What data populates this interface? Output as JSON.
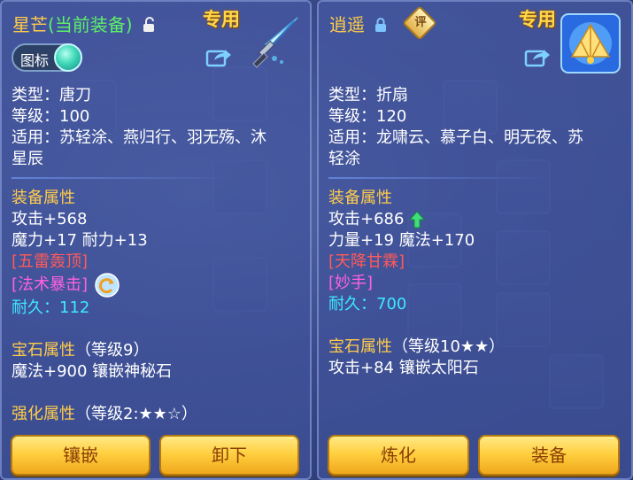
{
  "left": {
    "title_name": "星芒",
    "title_status": "(当前装备)",
    "exclusive_label": "专用",
    "toggle_label": "图标",
    "type_line": "类型：唐刀",
    "level_line": "等级：100",
    "usable_line1": "适用：苏轻涂、燕归行、羽无殇、沐",
    "usable_line2": "星辰",
    "attr_header": "装备属性",
    "attack": "攻击+568",
    "magic_stamina": "魔力+17 耐力+13",
    "skill1": "[五雷轰顶]",
    "skill2": "[法术暴击]",
    "durability_label": "耐久：",
    "durability_value": "112",
    "gem_header": "宝石属性",
    "gem_level": "（等级9）",
    "gem_effect": "魔法+900 镶嵌神秘石",
    "enhance_header": "强化属性",
    "enhance_level": "（等级2:★★☆）",
    "btn_inlay": "镶嵌",
    "btn_unequip": "卸下"
  },
  "right": {
    "title_name": "逍遥",
    "rating_label": "评",
    "exclusive_label": "专用",
    "type_line": "类型：折扇",
    "level_line": "等级：120",
    "usable_line1": "适用：龙啸云、慕子白、明无夜、苏",
    "usable_line2": "轻涂",
    "attr_header": "装备属性",
    "attack": "攻击+686",
    "strength_magic": "力量+19 魔法+170",
    "skill1": "[天降甘霖]",
    "skill2": "[妙手]",
    "durability_label": "耐久：",
    "durability_value": "700",
    "gem_header": "宝石属性",
    "gem_level": "（等级10★★）",
    "gem_effect": "攻击+84 镶嵌太阳石",
    "btn_refine": "炼化",
    "btn_equip": "装备"
  },
  "colors": {
    "gold": "#ffcc4a",
    "green": "#5cf06a",
    "red": "#ff5a5a",
    "pink": "#ff62e0",
    "cyan": "#3ee8ff",
    "button": "#ffd040"
  }
}
